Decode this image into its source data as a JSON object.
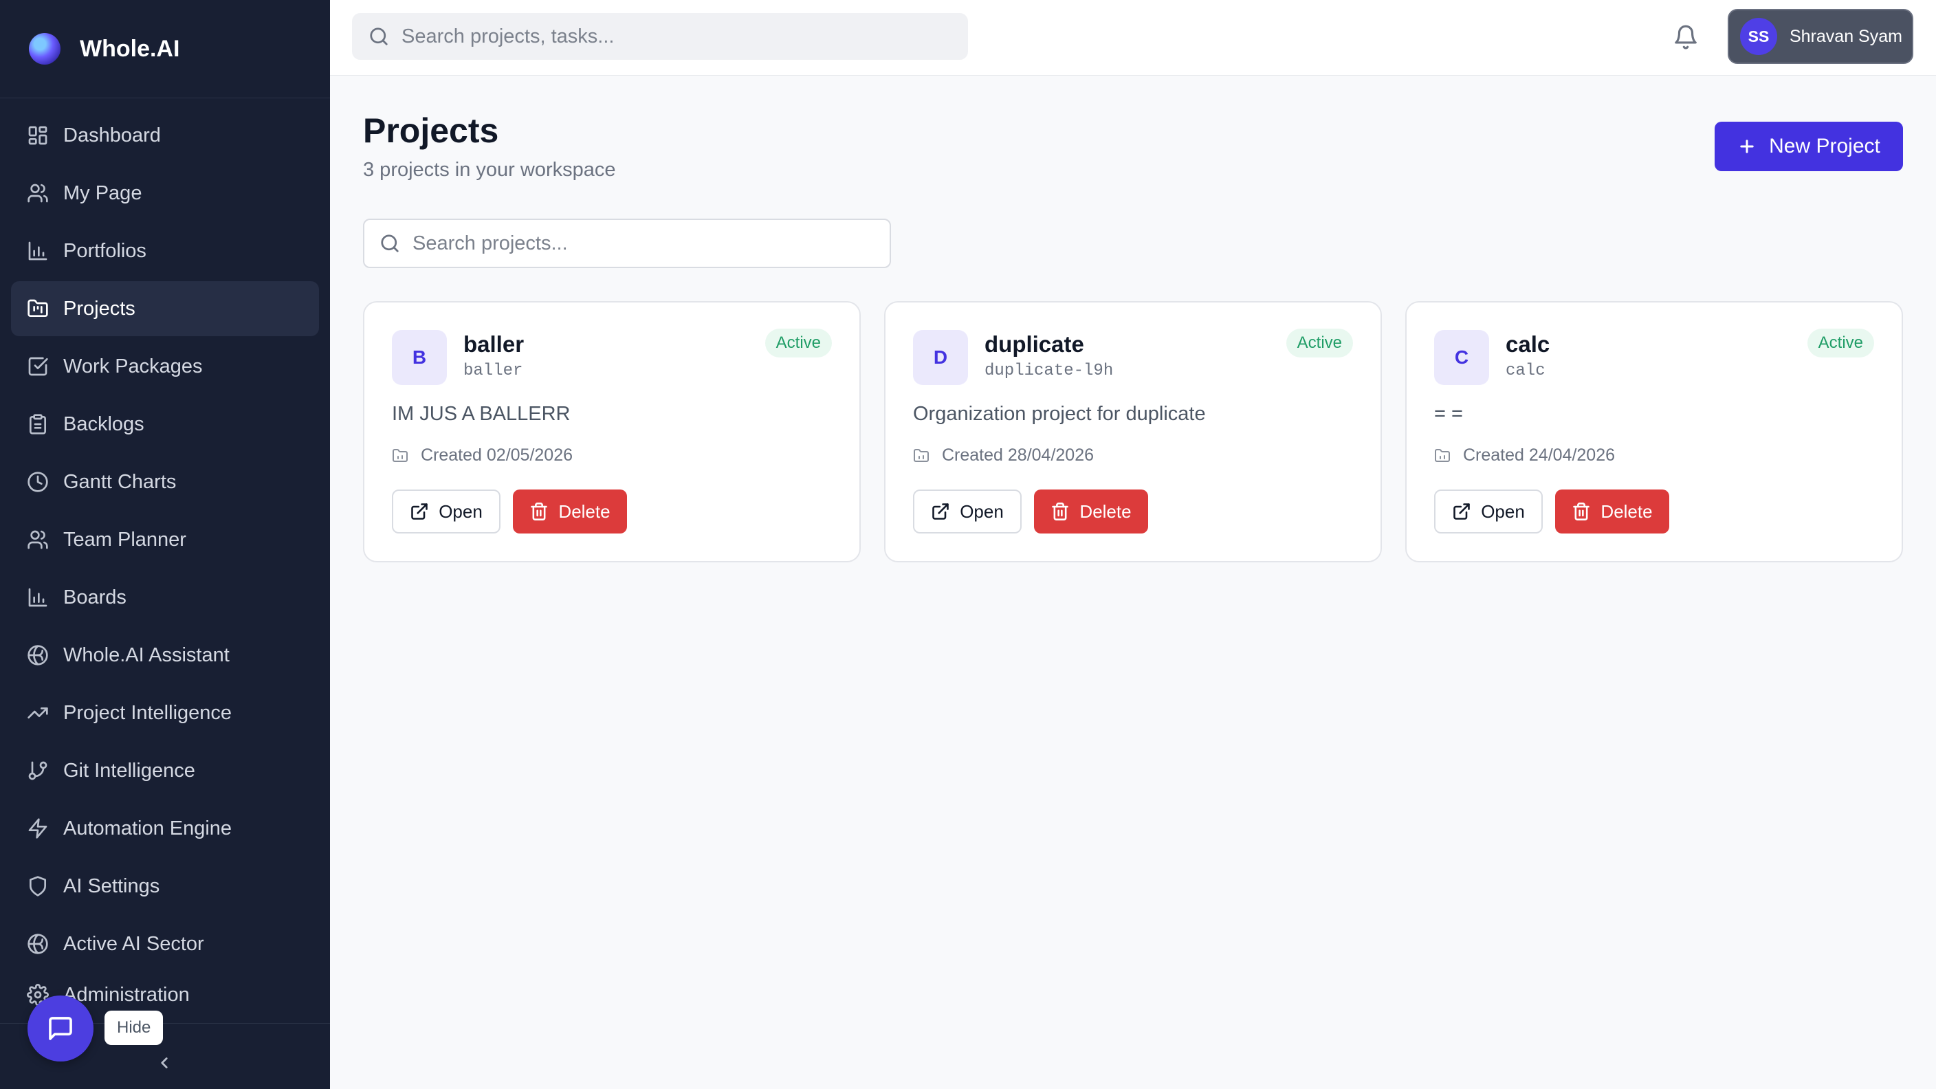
{
  "app": {
    "name": "Whole.AI"
  },
  "sidebar": {
    "items": [
      {
        "label": "Dashboard",
        "icon": "dashboard-icon"
      },
      {
        "label": "My Page",
        "icon": "user-icon"
      },
      {
        "label": "Portfolios",
        "icon": "bar-chart-icon"
      },
      {
        "label": "Projects",
        "icon": "folder-kanban-icon",
        "active": true
      },
      {
        "label": "Work Packages",
        "icon": "checkbox-icon"
      },
      {
        "label": "Backlogs",
        "icon": "clipboard-icon"
      },
      {
        "label": "Gantt Charts",
        "icon": "clock-icon"
      },
      {
        "label": "Team Planner",
        "icon": "users-icon"
      },
      {
        "label": "Boards",
        "icon": "bar-chart-icon"
      },
      {
        "label": "Whole.AI Assistant",
        "icon": "brain-icon"
      },
      {
        "label": "Project Intelligence",
        "icon": "trending-up-icon"
      },
      {
        "label": "Git Intelligence",
        "icon": "git-branch-icon"
      },
      {
        "label": "Automation Engine",
        "icon": "lightning-icon"
      },
      {
        "label": "AI Settings",
        "icon": "shield-icon"
      },
      {
        "label": "Active AI Sector",
        "icon": "brain-icon"
      },
      {
        "label": "Administration",
        "icon": "settings-icon"
      }
    ],
    "hide_tooltip": "Hide"
  },
  "topbar": {
    "search_placeholder": "Search projects, tasks...",
    "user": {
      "initials": "SS",
      "name": "Shravan Syam"
    }
  },
  "main": {
    "title": "Projects",
    "subtitle": "3 projects in your workspace",
    "new_project_label": "New Project",
    "search_placeholder": "Search projects...",
    "projects": [
      {
        "initial": "B",
        "name": "baller",
        "key": "baller",
        "status": "Active",
        "description": "IM JUS A BALLERR",
        "created": "Created 02/05/2026",
        "open_label": "Open",
        "delete_label": "Delete"
      },
      {
        "initial": "D",
        "name": "duplicate",
        "key": "duplicate-l9h",
        "status": "Active",
        "description": "Organization project for duplicate",
        "created": "Created 28/04/2026",
        "open_label": "Open",
        "delete_label": "Delete"
      },
      {
        "initial": "C",
        "name": "calc",
        "key": "calc",
        "status": "Active",
        "description": "= =",
        "created": "Created 24/04/2026",
        "open_label": "Open",
        "delete_label": "Delete"
      }
    ]
  },
  "colors": {
    "sidebar_bg": "#181f33",
    "accent": "#4332e0",
    "danger": "#dc3b3b",
    "status_active": "#1f9d66"
  }
}
